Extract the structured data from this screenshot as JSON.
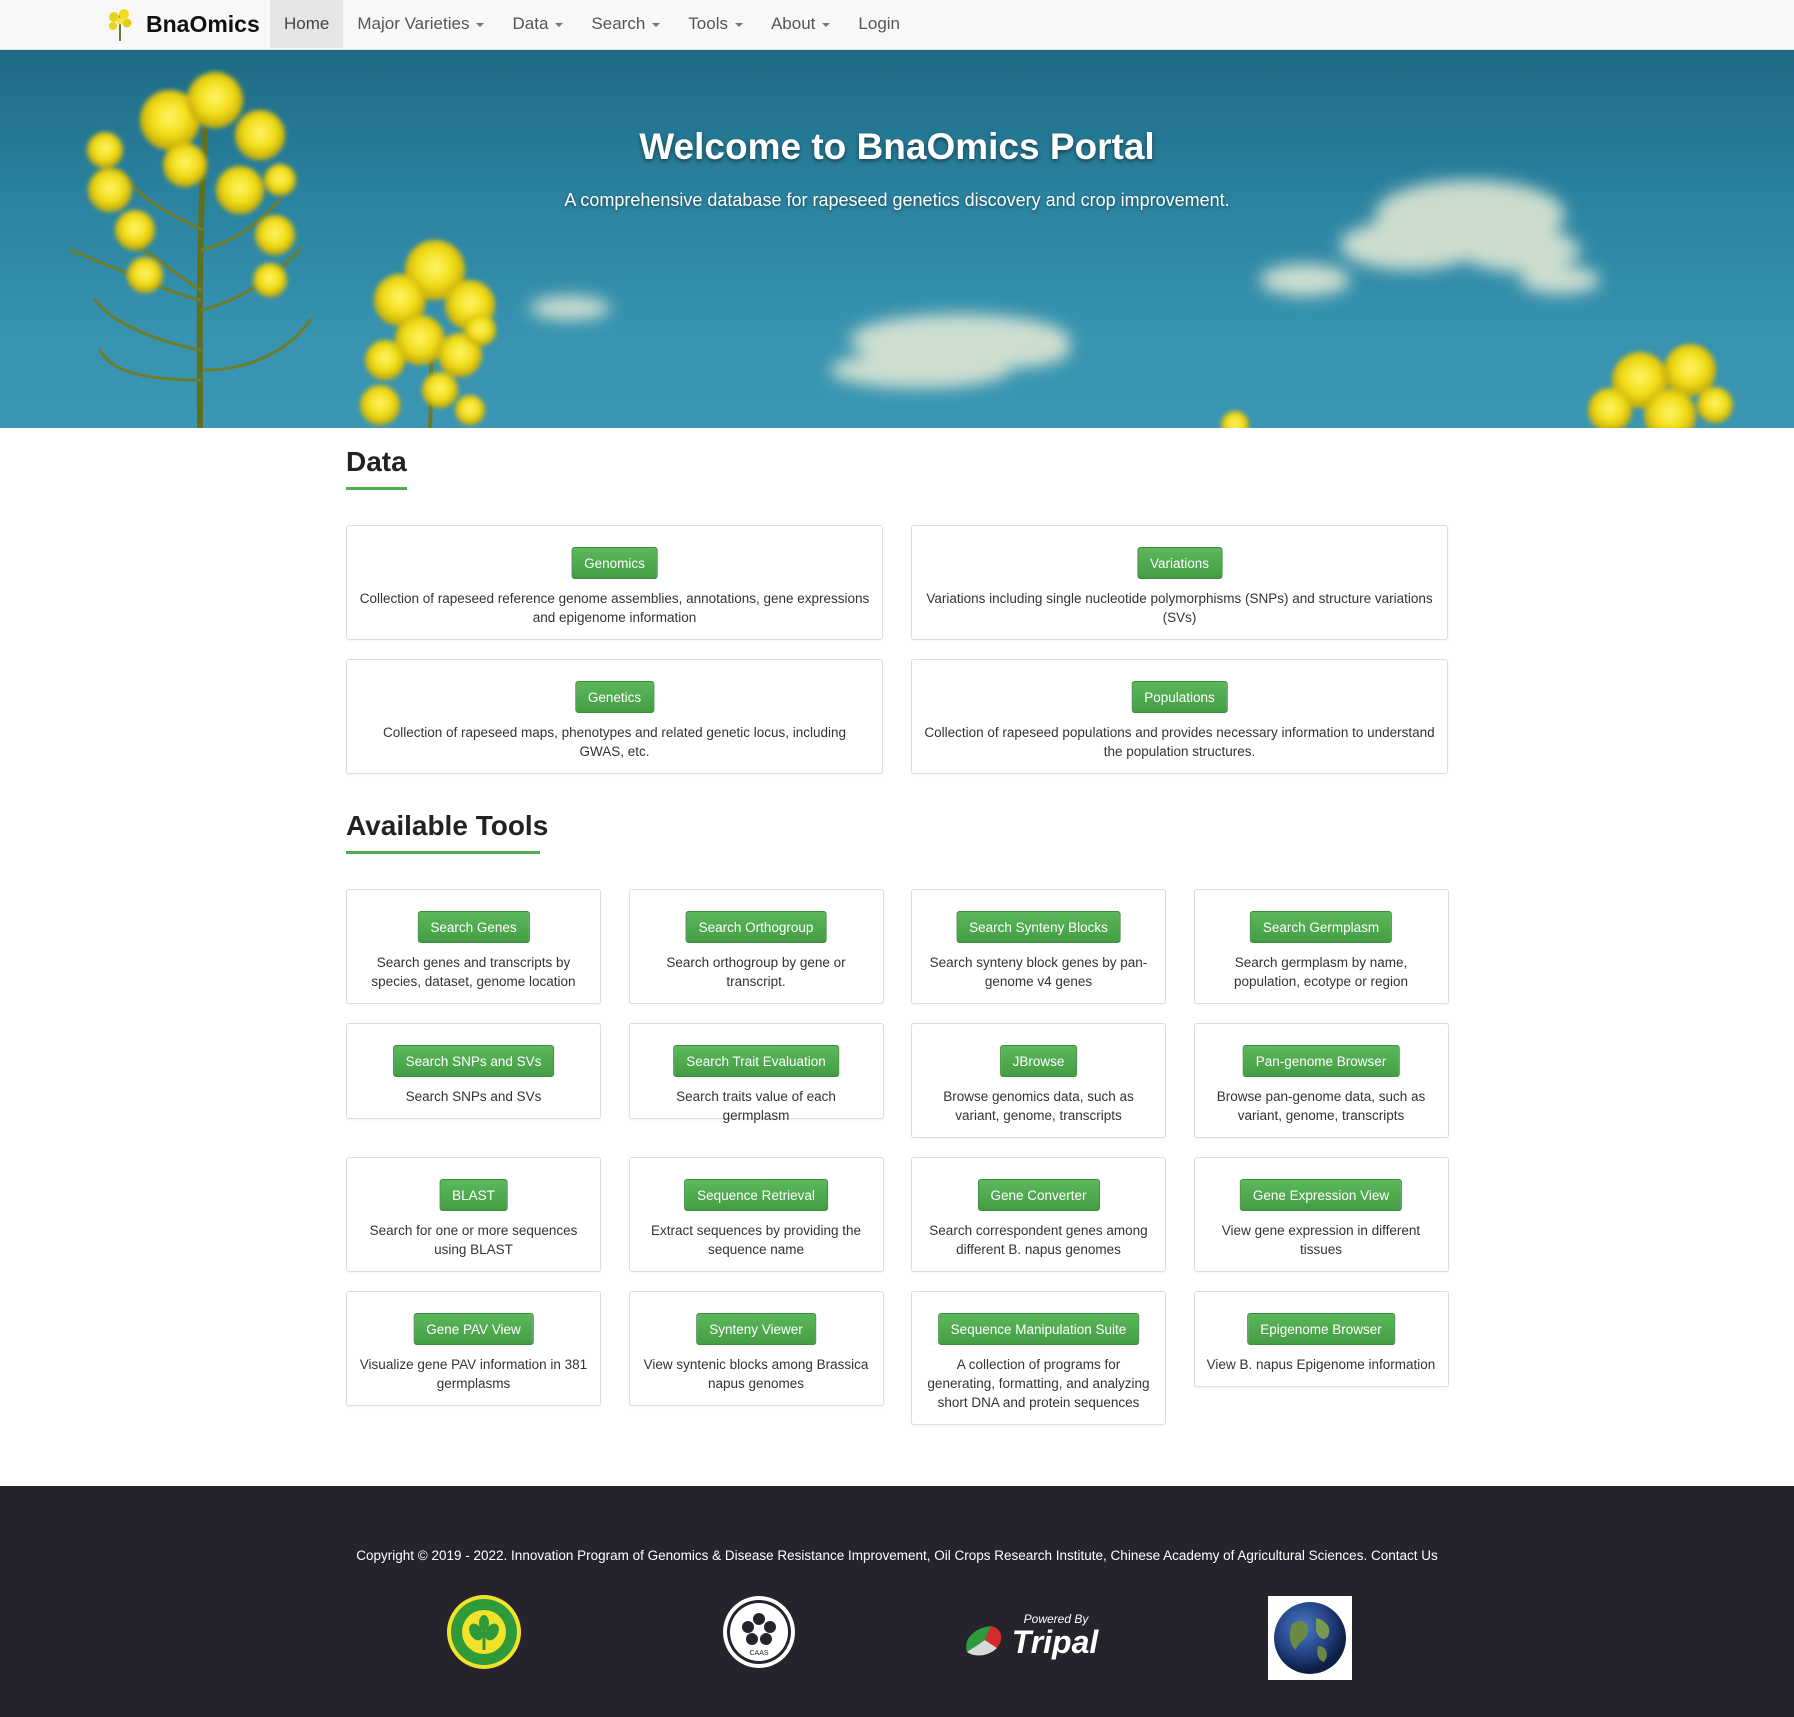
{
  "navbar": {
    "brand": "BnaOmics",
    "items": [
      {
        "label": "Home",
        "active": true,
        "dropdown": false
      },
      {
        "label": "Major Varieties",
        "active": false,
        "dropdown": true
      },
      {
        "label": "Data",
        "active": false,
        "dropdown": true
      },
      {
        "label": "Search",
        "active": false,
        "dropdown": true
      },
      {
        "label": "Tools",
        "active": false,
        "dropdown": true
      },
      {
        "label": "About",
        "active": false,
        "dropdown": true
      },
      {
        "label": "Login",
        "active": false,
        "dropdown": false
      }
    ]
  },
  "hero": {
    "title": "Welcome to BnaOmics Portal",
    "subtitle": "A comprehensive database for rapeseed genetics discovery and crop improvement."
  },
  "data_section": {
    "title": "Data",
    "cards": [
      {
        "button": "Genomics",
        "desc": "Collection of rapeseed reference genome assemblies, annotations, gene expressions and epigenome information"
      },
      {
        "button": "Variations",
        "desc": "Variations including single nucleotide polymorphisms (SNPs) and structure variations (SVs)"
      },
      {
        "button": "Genetics",
        "desc": "Collection of rapeseed maps, phenotypes and related genetic locus, including GWAS, etc."
      },
      {
        "button": "Populations",
        "desc": "Collection of rapeseed populations and provides necessary information to understand the population structures."
      }
    ]
  },
  "tools_section": {
    "title": "Available Tools",
    "cards": [
      {
        "button": "Search Genes",
        "desc": "Search genes and transcripts by species, dataset, genome location"
      },
      {
        "button": "Search Orthogroup",
        "desc": "Search orthogroup by gene or transcript."
      },
      {
        "button": "Search Synteny Blocks",
        "desc": "Search synteny block genes by pan-genome v4 genes"
      },
      {
        "button": "Search Germplasm",
        "desc": "Search germplasm by name, population, ecotype or region"
      },
      {
        "button": "Search SNPs and SVs",
        "desc": "Search SNPs and SVs"
      },
      {
        "button": "Search Trait Evaluation",
        "desc": "Search traits value of each germplasm"
      },
      {
        "button": "JBrowse",
        "desc": "Browse genomics data, such as variant, genome, transcripts"
      },
      {
        "button": "Pan-genome Browser",
        "desc": "Browse pan-genome data, such as variant, genome, transcripts"
      },
      {
        "button": "BLAST",
        "desc": "Search for one or more sequences using BLAST"
      },
      {
        "button": "Sequence Retrieval",
        "desc": "Extract sequences by providing the sequence name"
      },
      {
        "button": "Gene Converter",
        "desc": "Search correspondent genes among different B. napus genomes"
      },
      {
        "button": "Gene Expression View",
        "desc": "View gene expression in different tissues"
      },
      {
        "button": "Gene PAV View",
        "desc": "Visualize gene PAV information in 381 germplasms"
      },
      {
        "button": "Synteny Viewer",
        "desc": "View syntenic blocks among Brassica napus genomes"
      },
      {
        "button": "Sequence Manipulation Suite",
        "desc": "A collection of programs for generating, formatting, and analyzing short DNA and protein sequences"
      },
      {
        "button": "Epigenome Browser",
        "desc": "View B. napus Epigenome information"
      }
    ]
  },
  "footer": {
    "copyright": "Copyright © 2019 - 2022. Innovation Program of Genomics & Disease Resistance Improvement, Oil Crops Research Institute, Chinese Academy of Agricultural Sciences. Contact Us",
    "tripal_powered": "Powered By",
    "tripal_name": "Tripal",
    "caas_text": "CAAS"
  }
}
